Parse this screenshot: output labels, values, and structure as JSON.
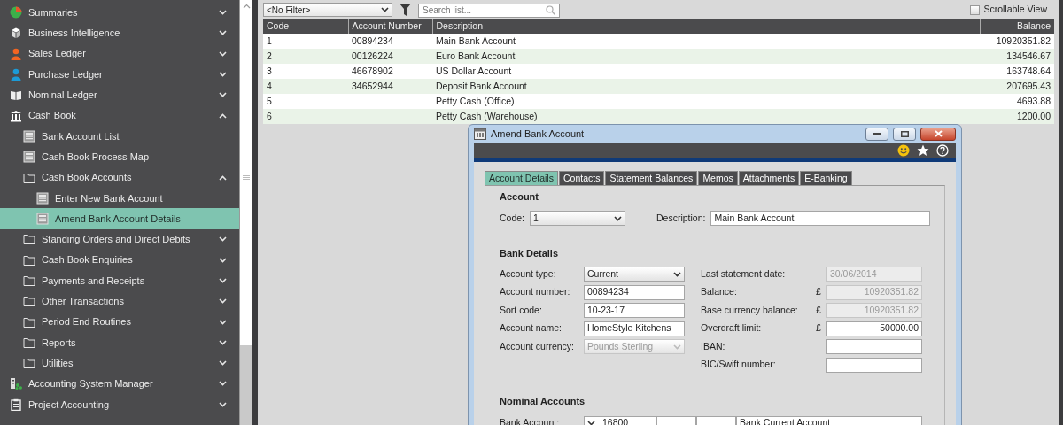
{
  "sidebar": {
    "items": [
      {
        "label": "Summaries",
        "kind": "module",
        "expanded": false,
        "selected": false
      },
      {
        "label": "Business Intelligence",
        "kind": "module",
        "expanded": false,
        "selected": false
      },
      {
        "label": "Sales Ledger",
        "kind": "module",
        "expanded": false,
        "selected": false
      },
      {
        "label": "Purchase Ledger",
        "kind": "module",
        "expanded": false,
        "selected": false
      },
      {
        "label": "Nominal Ledger",
        "kind": "module",
        "expanded": false,
        "selected": false
      },
      {
        "label": "Cash Book",
        "kind": "module",
        "expanded": true,
        "selected": false,
        "children": [
          {
            "label": "Bank Account List",
            "kind": "page",
            "selected": false
          },
          {
            "label": "Cash Book Process Map",
            "kind": "page",
            "selected": false
          },
          {
            "label": "Cash Book Accounts",
            "kind": "folder",
            "expanded": true,
            "selected": false,
            "children": [
              {
                "label": "Enter New Bank Account",
                "kind": "page",
                "selected": false
              },
              {
                "label": "Amend Bank Account Details",
                "kind": "page",
                "selected": true
              }
            ]
          },
          {
            "label": "Standing Orders and Direct Debits",
            "kind": "folder",
            "expanded": false,
            "selected": false
          },
          {
            "label": "Cash Book Enquiries",
            "kind": "folder",
            "expanded": false,
            "selected": false
          },
          {
            "label": "Payments and Receipts",
            "kind": "folder",
            "expanded": false,
            "selected": false
          },
          {
            "label": "Other Transactions",
            "kind": "folder",
            "expanded": false,
            "selected": false
          },
          {
            "label": "Period End Routines",
            "kind": "folder",
            "expanded": false,
            "selected": false
          },
          {
            "label": "Reports",
            "kind": "folder",
            "expanded": false,
            "selected": false
          },
          {
            "label": "Utilities",
            "kind": "folder",
            "expanded": false,
            "selected": false
          }
        ]
      },
      {
        "label": "Accounting System Manager",
        "kind": "module",
        "expanded": false,
        "selected": false
      },
      {
        "label": "Project Accounting",
        "kind": "module",
        "expanded": false,
        "selected": false
      }
    ]
  },
  "toolbar": {
    "filter": "<No Filter>",
    "search": {
      "placeholder": "Search list..."
    },
    "scrollable_view": {
      "label": "Scrollable View",
      "checked": false
    }
  },
  "table": {
    "columns": [
      "Code",
      "Account Number",
      "Description",
      "Balance"
    ],
    "rows": [
      [
        "1",
        "00894234",
        "Main Bank Account",
        "10920351.82"
      ],
      [
        "2",
        "00126224",
        "Euro Bank Account",
        "134546.67"
      ],
      [
        "3",
        "46678902",
        "US Dollar Account",
        "163748.64"
      ],
      [
        "4",
        "34652944",
        "Deposit Bank Account",
        "207695.43"
      ],
      [
        "5",
        "",
        "Petty Cash (Office)",
        "4693.88"
      ],
      [
        "6",
        "",
        "Petty Cash (Warehouse)",
        "1200.00"
      ]
    ]
  },
  "dialog": {
    "title": "Amend Bank Account",
    "tabs": [
      {
        "label": "Account Details",
        "selected": true
      },
      {
        "label": "Contacts",
        "selected": false
      },
      {
        "label": "Statement Balances",
        "selected": false
      },
      {
        "label": "Memos",
        "selected": false
      },
      {
        "label": "Attachments",
        "selected": false
      },
      {
        "label": "E-Banking",
        "selected": false
      }
    ],
    "account": {
      "heading": "Account",
      "code": {
        "label": "Code:",
        "value": "1"
      },
      "description": {
        "label": "Description:",
        "value": "Main Bank Account"
      }
    },
    "bank_details": {
      "heading": "Bank Details",
      "left_fields": [
        {
          "label": "Account type:",
          "value": "Current",
          "kind": "select",
          "disabled": false
        },
        {
          "label": "Account number:",
          "value": "00894234",
          "kind": "text",
          "disabled": false
        },
        {
          "label": "Sort code:",
          "value": "10-23-17",
          "kind": "text",
          "disabled": false
        },
        {
          "label": "Account name:",
          "value": "HomeStyle Kitchens",
          "kind": "text",
          "disabled": false
        },
        {
          "label": "Account currency:",
          "value": "Pounds Sterling",
          "kind": "select",
          "disabled": true
        }
      ],
      "right_fields": [
        {
          "label": "Last statement date:",
          "value": "30/06/2014",
          "kind": "text",
          "disabled": true
        },
        {
          "label": "Balance:",
          "currency": "£",
          "value": "10920351.82",
          "kind": "amount",
          "disabled": true
        },
        {
          "label": "Base currency balance:",
          "currency": "£",
          "value": "10920351.82",
          "kind": "amount",
          "disabled": true
        },
        {
          "label": "Overdraft limit:",
          "currency": "£",
          "value": "50000.00",
          "kind": "amount",
          "disabled": false
        },
        {
          "label": "IBAN:",
          "kind": "text",
          "disabled": false
        },
        {
          "label": "BIC/Swift number:",
          "kind": "text",
          "disabled": false
        }
      ]
    },
    "nominal": {
      "heading": "Nominal Accounts",
      "label": "Bank Account:",
      "code": "16800",
      "name": "Bank Current Account"
    }
  }
}
